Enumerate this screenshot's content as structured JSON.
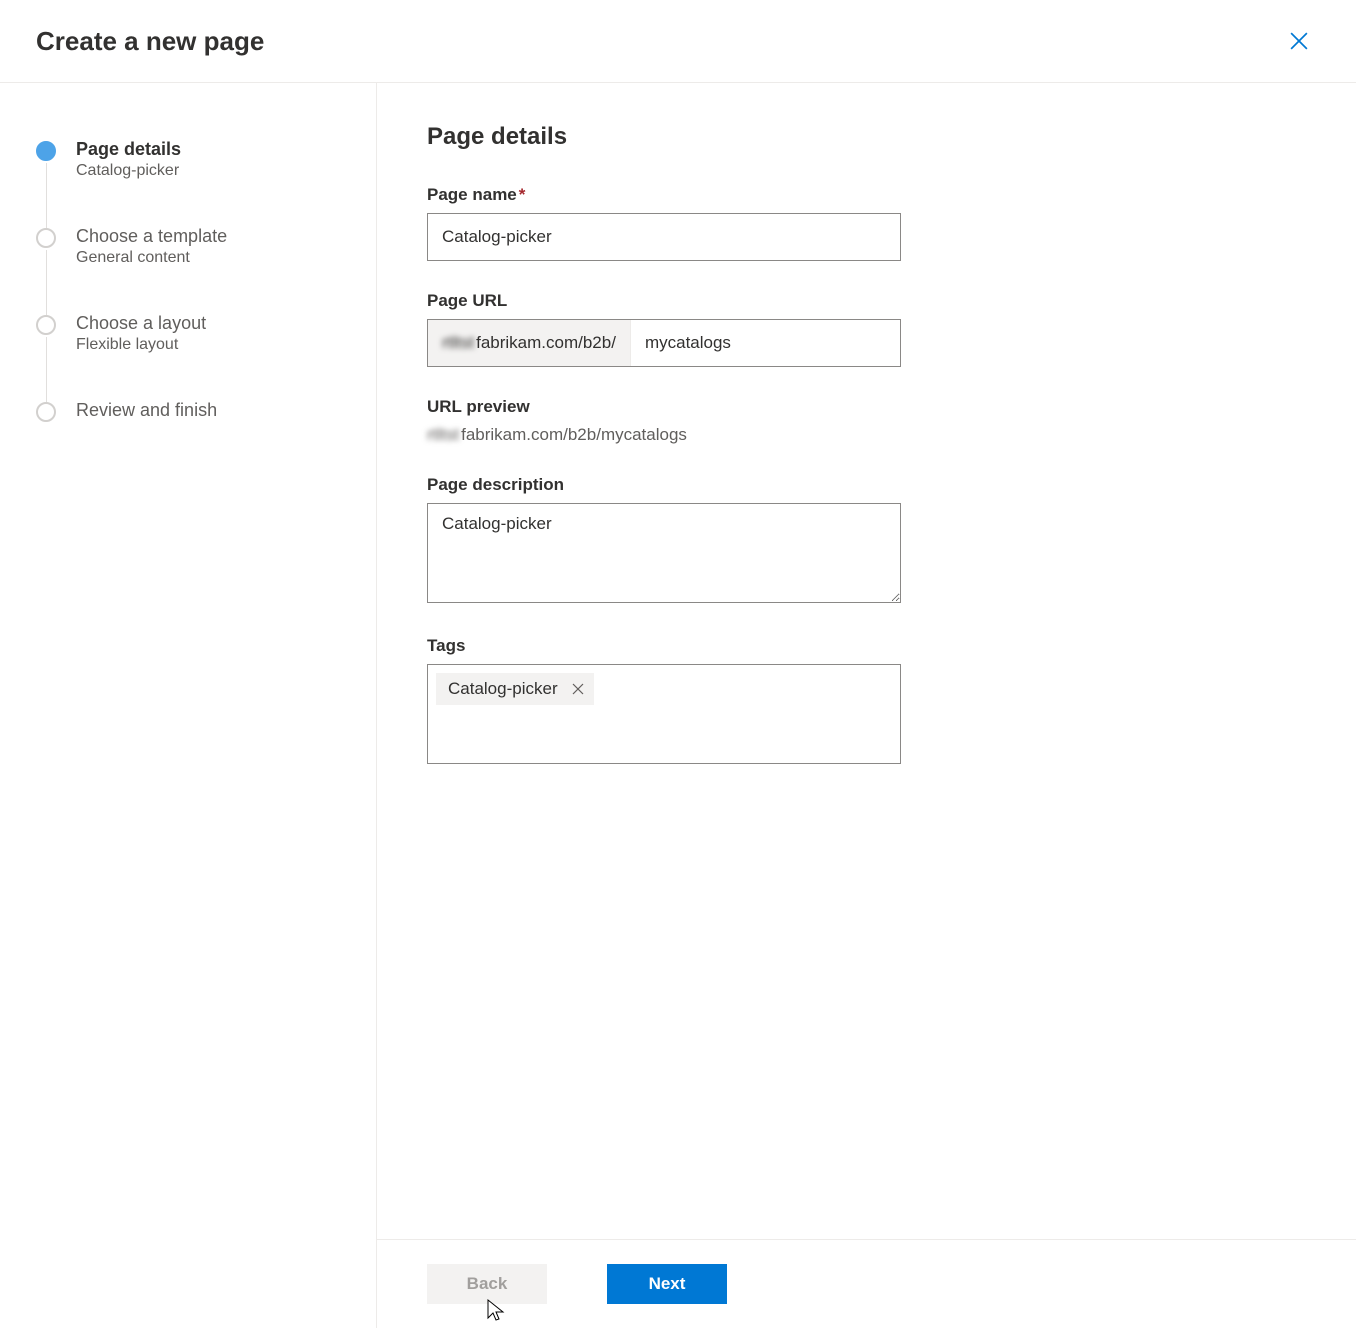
{
  "dialog": {
    "title": "Create a new page"
  },
  "steps": [
    {
      "title": "Page details",
      "sub": "Catalog-picker",
      "active": true
    },
    {
      "title": "Choose a template",
      "sub": "General content",
      "active": false
    },
    {
      "title": "Choose a layout",
      "sub": "Flexible layout",
      "active": false
    },
    {
      "title": "Review and finish",
      "sub": "",
      "active": false
    }
  ],
  "form": {
    "heading": "Page details",
    "page_name": {
      "label": "Page name",
      "value": "Catalog-picker"
    },
    "page_url": {
      "label": "Page URL",
      "prefix_blur": "rtltst",
      "prefix": "fabrikam.com/b2b/",
      "value": "mycatalogs"
    },
    "url_preview": {
      "label": "URL preview",
      "blur": "rtltst",
      "value": "fabrikam.com/b2b/mycatalogs"
    },
    "description": {
      "label": "Page description",
      "value": "Catalog-picker"
    },
    "tags": {
      "label": "Tags",
      "items": [
        "Catalog-picker"
      ]
    }
  },
  "footer": {
    "back": "Back",
    "next": "Next"
  }
}
